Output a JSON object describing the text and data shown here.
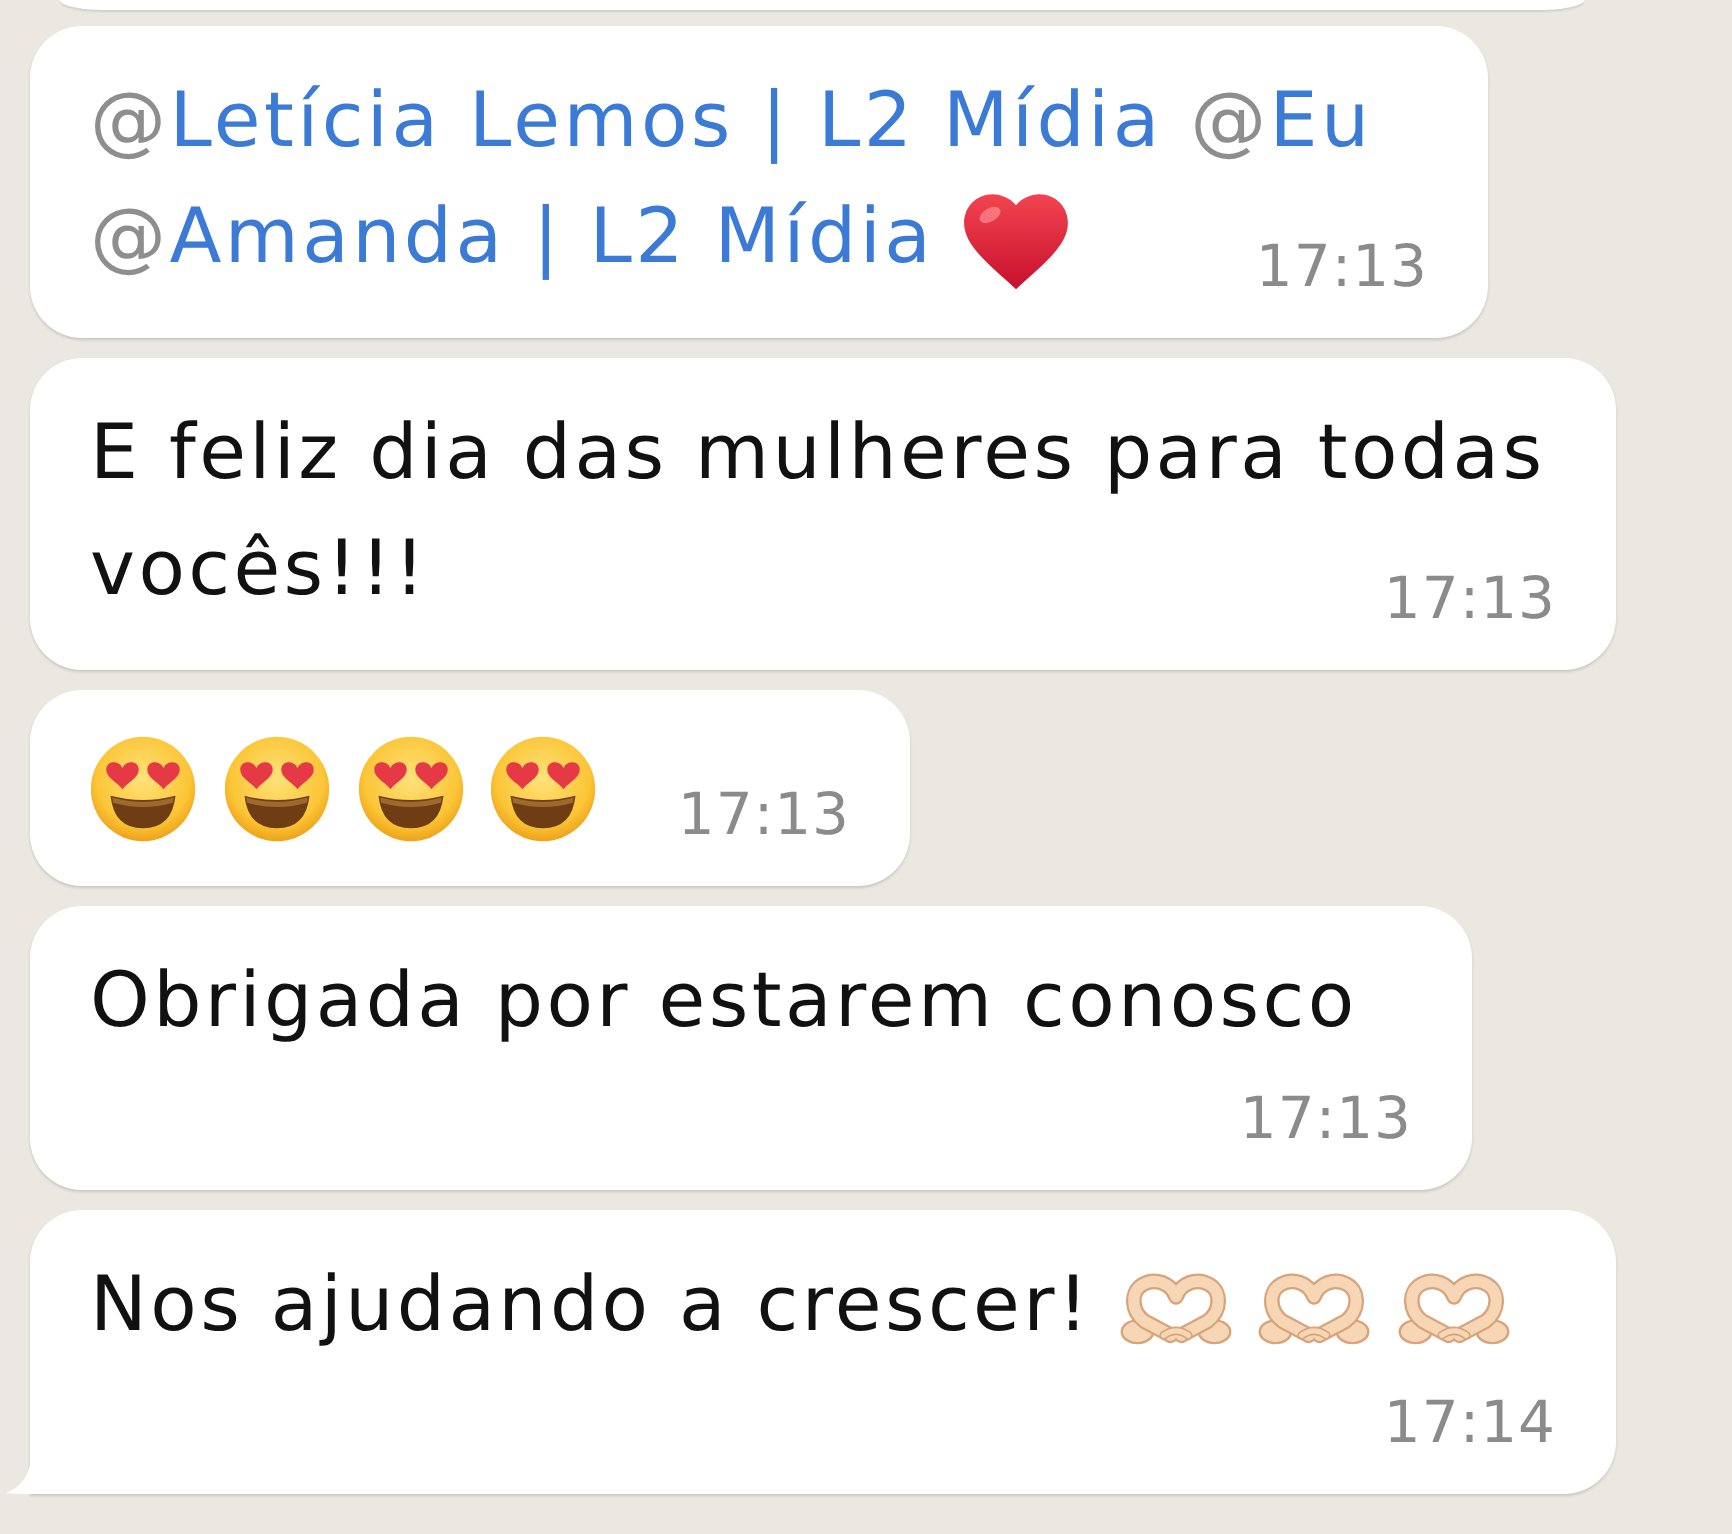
{
  "chat": {
    "messages": [
      {
        "parts": [
          {
            "kind": "mention",
            "at": "@",
            "name": "Letícia Lemos | L2 Mídia"
          },
          {
            "kind": "mention",
            "at": "@",
            "name": "Eu"
          },
          {
            "kind": "mention",
            "at": "@",
            "name": "Amanda | L2 Mídia"
          },
          {
            "kind": "heart"
          }
        ],
        "time": "17:13",
        "tail": false
      },
      {
        "parts": [
          {
            "kind": "text",
            "lines": [
              "E feliz dia das mulheres para todas",
              "vocês!!!"
            ]
          }
        ],
        "time": "17:13",
        "tail": false
      },
      {
        "parts": [
          {
            "kind": "hearteyes"
          },
          {
            "kind": "hearteyes"
          },
          {
            "kind": "hearteyes"
          },
          {
            "kind": "hearteyes"
          }
        ],
        "time": "17:13",
        "tail": false
      },
      {
        "parts": [
          {
            "kind": "text",
            "lines": [
              "Obrigada por estarem conosco"
            ]
          }
        ],
        "time": "17:13",
        "tail": false
      },
      {
        "parts": [
          {
            "kind": "text",
            "lines": [
              "Nos ajudando a crescer!"
            ]
          },
          {
            "kind": "handheart"
          },
          {
            "kind": "handheart"
          },
          {
            "kind": "handheart"
          }
        ],
        "time": "17:14",
        "tail": true
      }
    ]
  }
}
